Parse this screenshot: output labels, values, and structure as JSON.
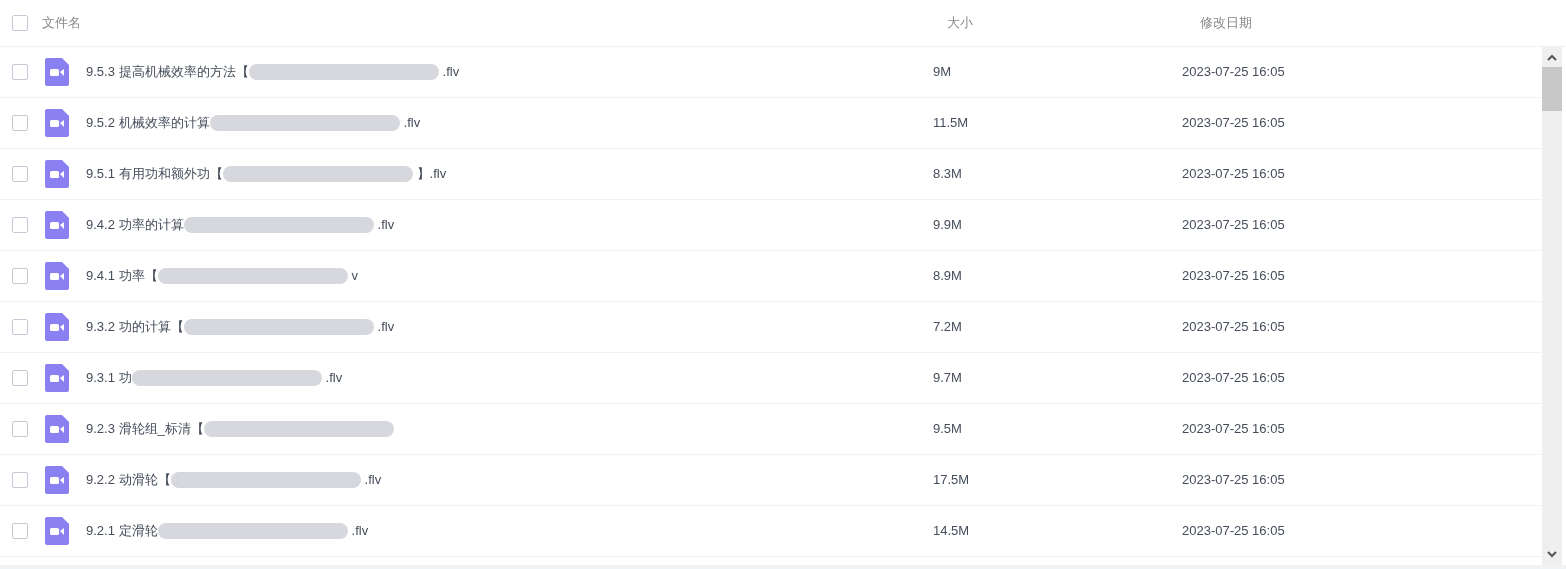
{
  "header": {
    "checked": false,
    "columns": [
      "文件名",
      "大小",
      "修改日期"
    ]
  },
  "rows": [
    {
      "checked": false,
      "name": "9.5.3 提高机械效率的方法【",
      "suffix": ".flv",
      "size": "9M",
      "date": "2023-07-25 16:05"
    },
    {
      "checked": false,
      "name": "9.5.2 机械效率的计算",
      "suffix": ".flv",
      "size": "11.5M",
      "date": "2023-07-25 16:05"
    },
    {
      "checked": false,
      "name": "9.5.1 有用功和额外功【",
      "suffix": "】.flv",
      "size": "8.3M",
      "date": "2023-07-25 16:05"
    },
    {
      "checked": false,
      "name": "9.4.2 功率的计算",
      "suffix": ".flv",
      "size": "9.9M",
      "date": "2023-07-25 16:05"
    },
    {
      "checked": false,
      "name": "9.4.1 功率【",
      "suffix": "v",
      "size": "8.9M",
      "date": "2023-07-25 16:05"
    },
    {
      "checked": false,
      "name": "9.3.2 功的计算【",
      "suffix": ".flv",
      "size": "7.2M",
      "date": "2023-07-25 16:05"
    },
    {
      "checked": false,
      "name": "9.3.1 功",
      "suffix": ".flv",
      "size": "9.7M",
      "date": "2023-07-25 16:05"
    },
    {
      "checked": false,
      "name": "9.2.3 滑轮组_标清【",
      "size": "9.5M",
      "date": "2023-07-25 16:05"
    },
    {
      "checked": false,
      "name": "9.2.2 动滑轮【",
      "suffix": ".flv",
      "size": "17.5M",
      "date": "2023-07-25 16:05"
    },
    {
      "checked": false,
      "name": "9.2.1 定滑轮",
      "suffix": ".flv",
      "size": "14.5M",
      "date": "2023-07-25 16:05"
    }
  ]
}
